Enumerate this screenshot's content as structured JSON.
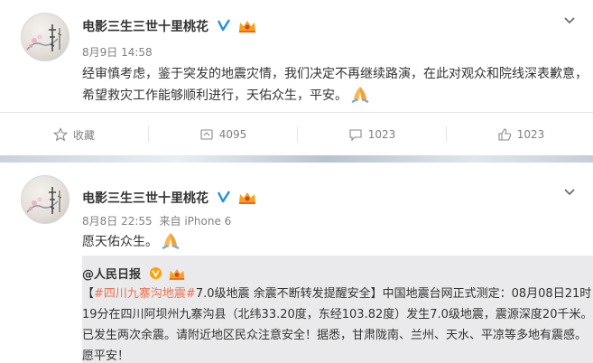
{
  "post1": {
    "author": "电影三生三世十里桃花",
    "time": "8月9日 14:58",
    "text": "经审慎考虑，鉴于突发的地震灾情，我们决定不再继续路演，在此对观众和院线深表歉意，希望救灾工作能够顺利进行，天佑众生，平安。",
    "emoji": "pray-emoji",
    "actions": {
      "favorite_label": "收藏",
      "repost_count": "4095",
      "comment_count": "1023",
      "like_count": "1023"
    }
  },
  "post2": {
    "author": "电影三生三世十里桃花",
    "time": "8月8日 22:55",
    "source_prefix": "来自",
    "source": "iPhone 6",
    "text": "愿天佑众生。",
    "emoji": "pray-emoji",
    "repost": {
      "author": "@人民日报",
      "topic": "#四川九寨沟地震#",
      "text": "7.0级地震 余震不断转发提醒安全】中国地震台网正式测定：08月08日21时19分在四川阿坝州九寨沟县（北纬33.20度，东经103.82度）发生7.0级地震，震源深度20千米。已发生两次余震。请附近地区民众注意安全！据悉，甘肃陇南、兰州、天水、平凉等多地有震感。愿平安！",
      "text_open": "【"
    }
  },
  "colors": {
    "topic": "#eb7350",
    "verified": "#ffa00a",
    "muted": "#808080"
  }
}
